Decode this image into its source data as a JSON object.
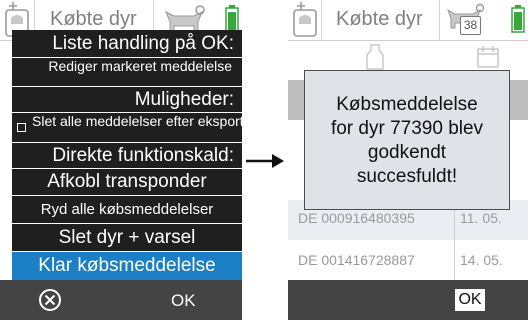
{
  "left": {
    "header": {
      "title": "Købte dyr"
    },
    "menu": {
      "heading_list_action": "Liste handling på OK:",
      "edit_marked_message": "Rediger markeret meddelelse",
      "heading_options": "Muligheder:",
      "delete_all_after_export": "Slet alle meddelelser efter eksport",
      "heading_direct_call": "Direkte funktionskald:",
      "detach_transponder": "Afkobl transponder",
      "clear_all_purchase_messages": "Ryd alle købsmeddelelser",
      "delete_animal_alert": "Slet dyr + varsel",
      "clear_purchase_message": "Klar købsmeddelelse"
    },
    "bottom": {
      "ok_label": "OK"
    }
  },
  "right": {
    "header": {
      "title": "Købte dyr",
      "calendar_count": "38"
    },
    "rows": [
      {
        "id": "DE 000916480395",
        "date": "11. 05."
      },
      {
        "id": "DE 001416728887",
        "date": "14. 05."
      }
    ],
    "dialog": {
      "lines": [
        "Købsmeddelelse",
        "for dyr 77390 blev",
        "godkendt",
        "succesfuldt!"
      ]
    },
    "bottom": {
      "ok_label": "OK"
    }
  },
  "colors": {
    "menu_bg": "#1f1f1f",
    "menu_selected": "#1a7fc4",
    "bottom_bar": "#444444",
    "dialog_bg": "#dfe2e6",
    "battery": "#3aa53a"
  }
}
